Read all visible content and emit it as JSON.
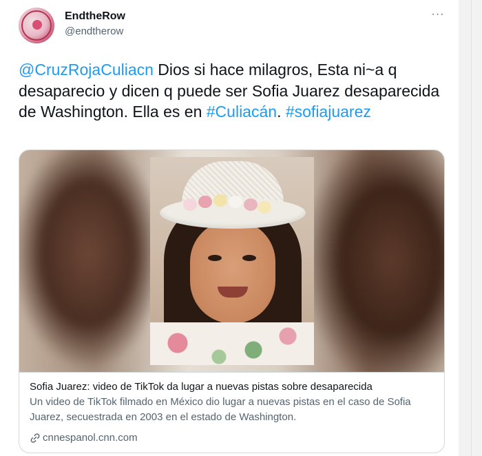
{
  "user": {
    "display_name": "EndtheRow",
    "handle": "@endtherow",
    "avatar_icon": "profile-avatar"
  },
  "menu": {
    "more_label": "···"
  },
  "tweet": {
    "mention": "@CruzRojaCuliacn",
    "text_part1": " Dios si hace milagros, Esta ni~a q desaparecio y dicen q puede ser Sofia Juarez desaparecida de Washington. Ella es en ",
    "hashtag1": "#Culiacán",
    "text_part2": ". ",
    "hashtag2": "#sofiajuarez"
  },
  "card": {
    "title": "Sofia Juarez: video de TikTok da lugar a nuevas pistas sobre desaparecida",
    "description": "Un video de TikTok filmado en México dio lugar a nuevas pistas en el caso de Sofia Juarez, secuestrada en 2003 en el estado de Washington.",
    "domain": "cnnespanol.cnn.com",
    "domain_icon": "link-icon"
  },
  "colors": {
    "accent": "#1d9bf0",
    "text_primary": "#0f1419",
    "text_secondary": "#536471",
    "border": "#cfd9de"
  }
}
